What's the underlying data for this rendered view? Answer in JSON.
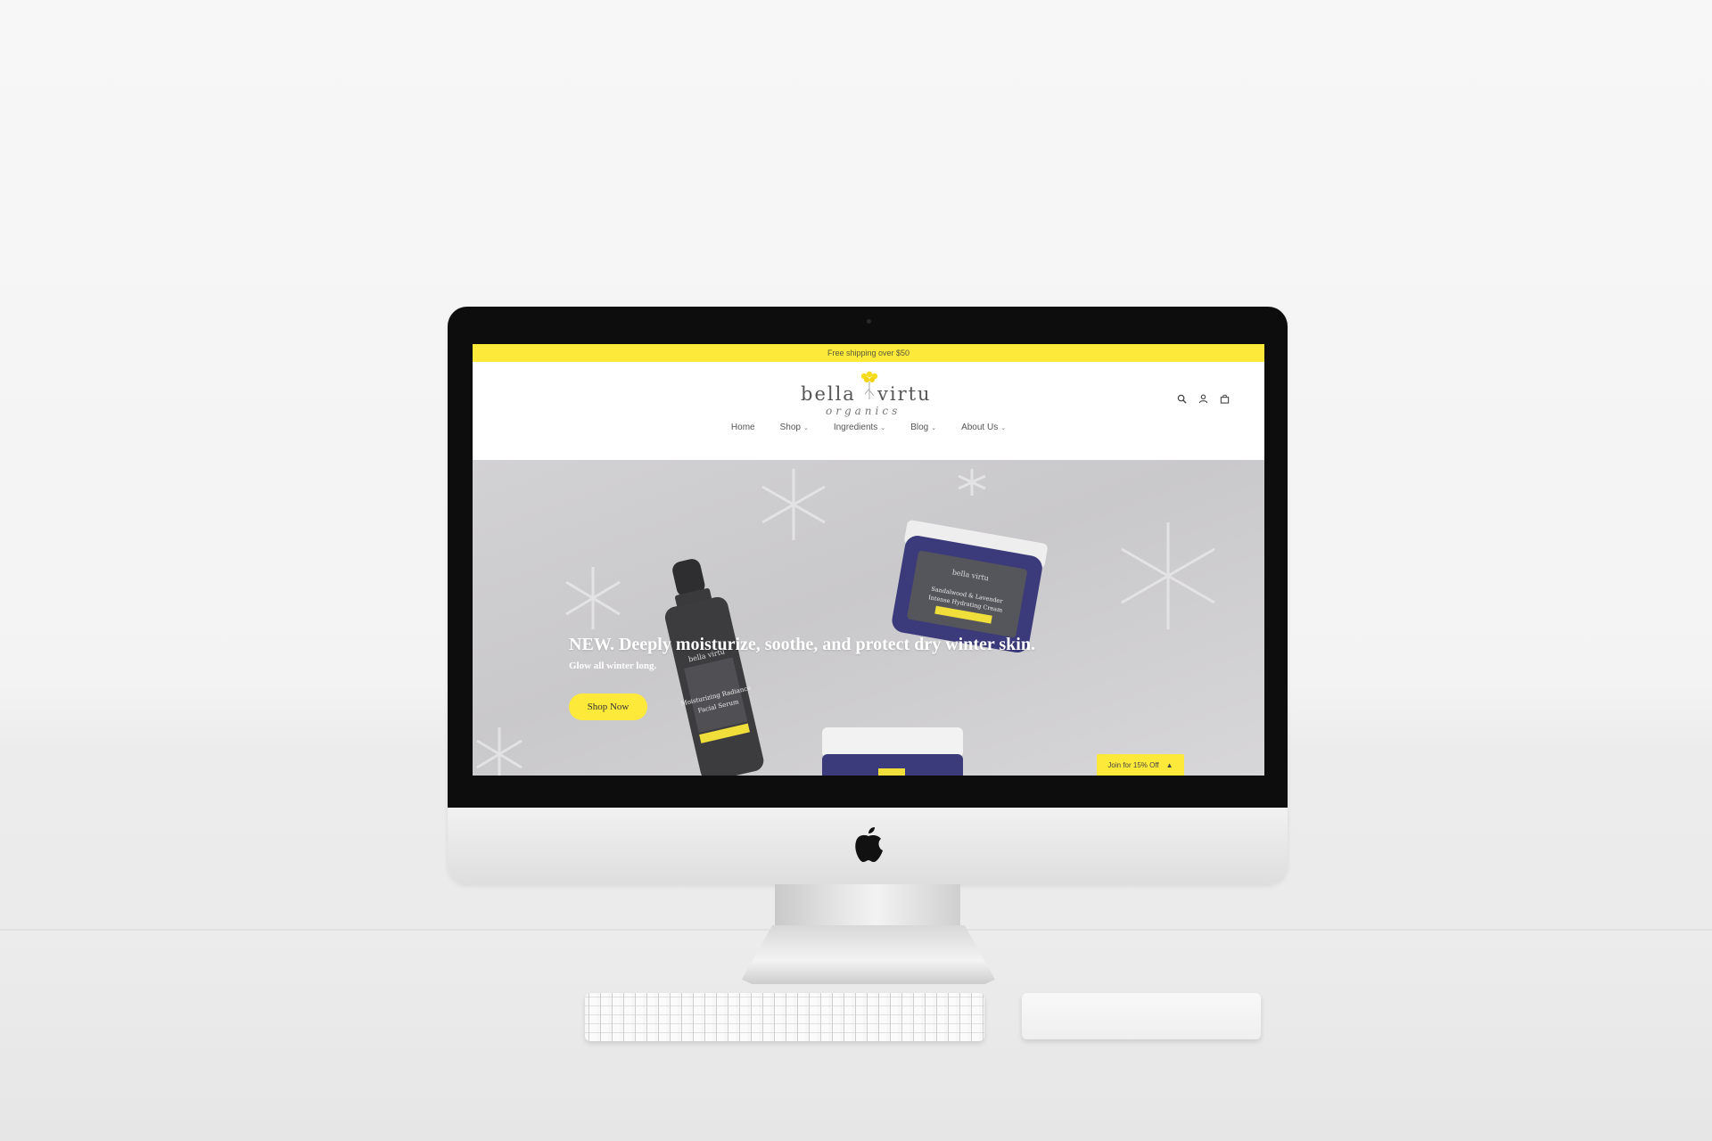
{
  "website": {
    "announcement": "Free shipping over $50",
    "brand": {
      "name_left": "bella",
      "name_right": "virtu",
      "tagline": "organics"
    },
    "header_icons": [
      "search-icon",
      "account-icon",
      "cart-icon"
    ],
    "nav": [
      {
        "label": "Home",
        "dropdown": false
      },
      {
        "label": "Shop",
        "dropdown": true
      },
      {
        "label": "Ingredients",
        "dropdown": true
      },
      {
        "label": "Blog",
        "dropdown": true
      },
      {
        "label": "About Us",
        "dropdown": true
      }
    ],
    "hero": {
      "title": "NEW. Deeply moisturize, soothe, and protect dry winter skin.",
      "subtitle": "Glow all winter long.",
      "cta": "Shop Now"
    },
    "popup_tab": {
      "label": "Join for 15% Off",
      "icon": "caret-up-icon"
    },
    "products": {
      "serum_brand": "bella virtu",
      "serum_name_line1": "Moisturizing Radiance",
      "serum_name_line2": "Facial Serum",
      "jar_brand": "bella virtu",
      "jar_name_line1": "Sandalwood & Lavender",
      "jar_name_line2": "Intense Hydrating Cream"
    }
  },
  "colors": {
    "accent_yellow": "#fde93a",
    "bezel": "#0d0d0e",
    "hero_bg": "#cfced0",
    "product_purple": "#3b3a7a"
  }
}
